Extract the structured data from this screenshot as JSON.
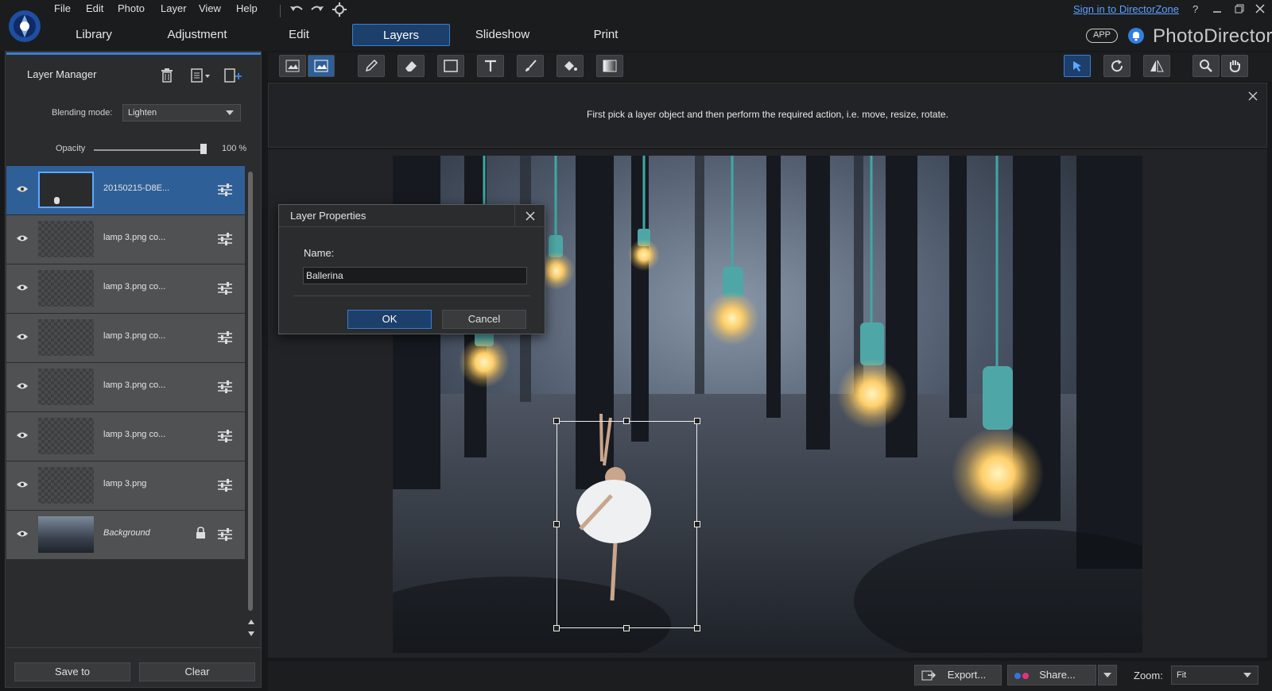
{
  "menu": [
    "File",
    "Edit",
    "Photo",
    "Layer",
    "View",
    "Help"
  ],
  "tabs": [
    "Library",
    "Adjustment",
    "Edit",
    "Layers",
    "Slideshow",
    "Print"
  ],
  "topright": {
    "signin": "Sign in to DirectorZone",
    "help": "?",
    "app": "APP",
    "brand": "PhotoDirector"
  },
  "panel": {
    "title": "Layer Manager",
    "blending_label": "Blending mode:",
    "blending_value": "Lighten",
    "opacity_label": "Opacity",
    "opacity_value": "100 %",
    "opacity_level": 1.0
  },
  "layers": [
    {
      "name": "20150215-D8E..."
    },
    {
      "name": "lamp 3.png co..."
    },
    {
      "name": "lamp 3.png co..."
    },
    {
      "name": "lamp 3.png co..."
    },
    {
      "name": "lamp 3.png co..."
    },
    {
      "name": "lamp 3.png co..."
    },
    {
      "name": "lamp 3.png"
    },
    {
      "name": "Background"
    }
  ],
  "buttons": {
    "save": "Save to",
    "clear": "Clear",
    "export": "Export...",
    "share": "Share...",
    "zoom_label": "Zoom:",
    "zoom_value": "Fit"
  },
  "hint": "First pick a layer object and then perform the required action, i.e. move, resize, rotate.",
  "dialog": {
    "title": "Layer Properties",
    "name_label": "Name:",
    "name_value": "Ballerina",
    "ok": "OK",
    "cancel": "Cancel"
  },
  "colors": {
    "accent": "#3b7fd0",
    "selected": "#2f5f97",
    "link": "#5aa2ff"
  }
}
